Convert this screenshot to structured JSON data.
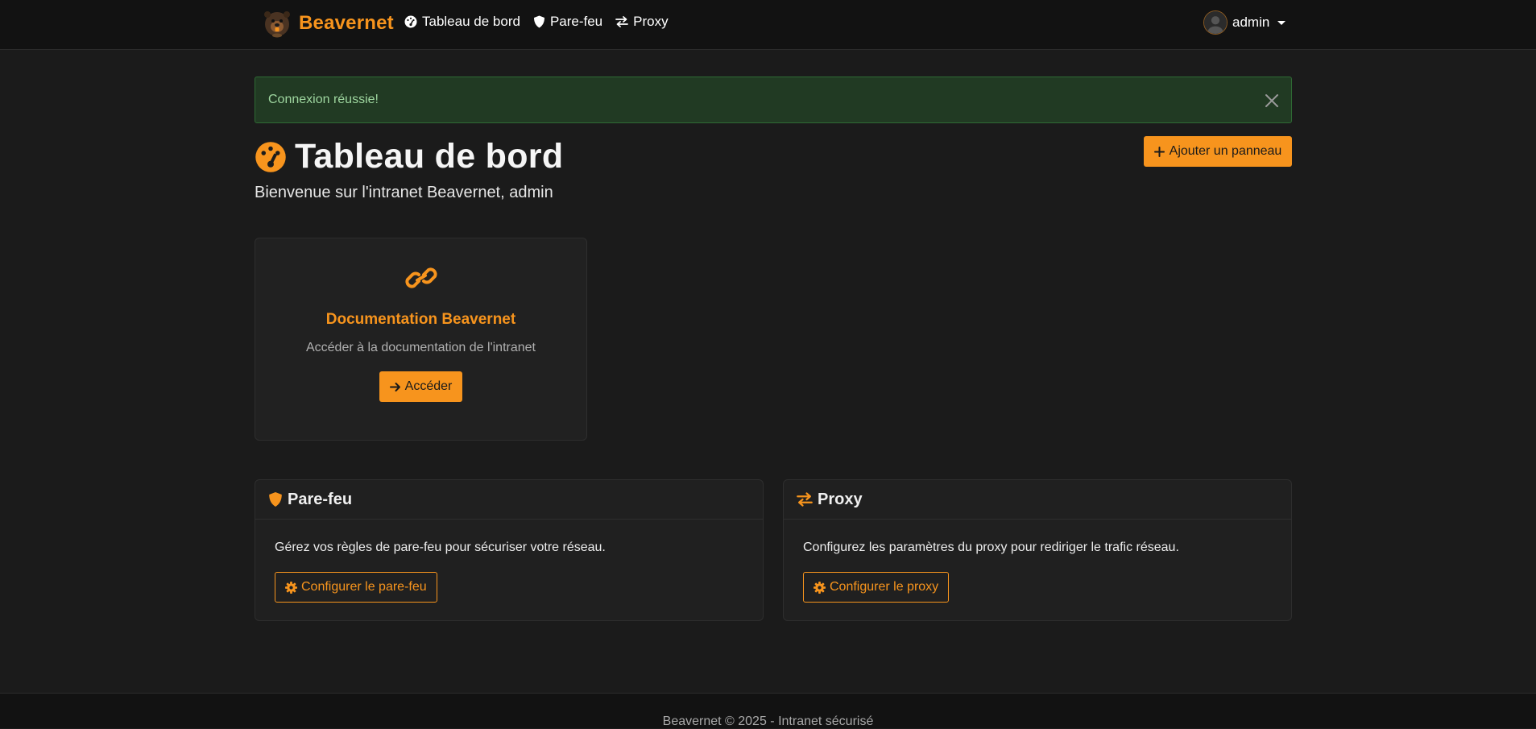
{
  "colors": {
    "accent": "#f7941d",
    "background": "#1b1b1b",
    "navbar": "#121212",
    "alert_bg": "#213a23",
    "alert_text": "#9ed69f"
  },
  "navbar": {
    "brand": "Beavernet",
    "brand_icon": "beaver-logo-icon",
    "links": [
      {
        "label": "Tableau de bord",
        "icon": "dashboard-icon"
      },
      {
        "label": "Pare-feu",
        "icon": "shield-icon"
      },
      {
        "label": "Proxy",
        "icon": "arrows-exchange-icon"
      }
    ],
    "user": {
      "name": "admin",
      "icon": "avatar-icon"
    }
  },
  "alert": {
    "message": "Connexion réussie!",
    "close_icon": "close-icon"
  },
  "header": {
    "title": "Tableau de bord",
    "title_icon": "dashboard-icon",
    "subtitle": "Bienvenue sur l'intranet Beavernet, admin",
    "add_button": "Ajouter un panneau"
  },
  "doc_card": {
    "icon": "link-icon",
    "title": "Documentation Beavernet",
    "description": "Accéder à la documentation de l'intranet",
    "button": "Accéder"
  },
  "sections": [
    {
      "title": "Pare-feu",
      "icon": "shield-icon",
      "description": "Gérez vos règles de pare-feu pour sécuriser votre réseau.",
      "button": "Configurer le pare-feu"
    },
    {
      "title": "Proxy",
      "icon": "arrows-exchange-icon",
      "description": "Configurez les paramètres du proxy pour rediriger le trafic réseau.",
      "button": "Configurer le proxy"
    }
  ],
  "footer": {
    "text": "Beavernet © 2025 - Intranet sécurisé"
  }
}
